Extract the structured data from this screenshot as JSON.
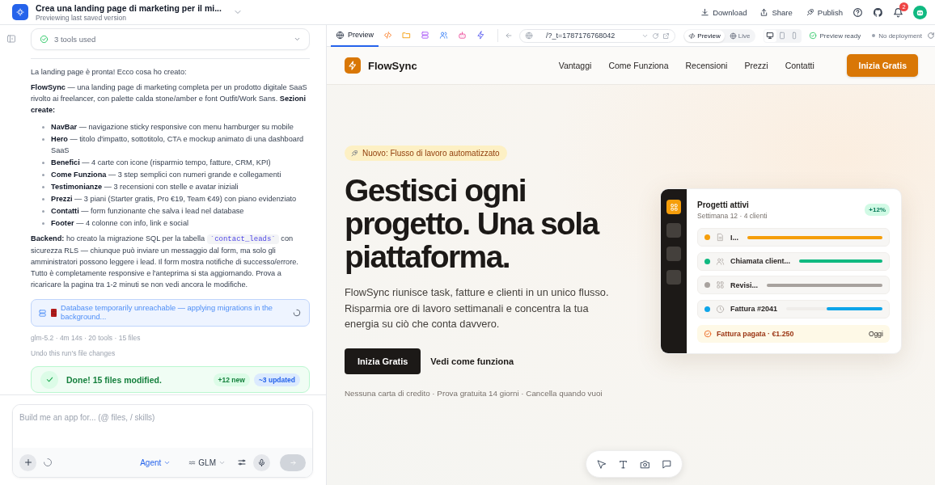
{
  "header": {
    "title": "Crea una landing page di marketing per il mi...",
    "subtitle": "Previewing last saved version",
    "actions": [
      {
        "label": "Download"
      },
      {
        "label": "Share"
      },
      {
        "label": "Publish"
      }
    ],
    "notification_count": "2"
  },
  "chat": {
    "tools_summary": "3 tools used",
    "intro": "La landing page è pronta! Ecco cosa ho creato:",
    "summary": "**FlowSync** — una landing page di marketing completa per un prodotto digitale SaaS rivolto ai freelancer, con palette calda stone/amber e font Outfit/Work Sans. **Sezioni create:**",
    "sections": [
      "**NavBar** — navigazione sticky responsive con menu hamburger su mobile",
      "**Hero** — titolo d'impatto, sottotitolo, CTA e mockup animato di una dashboard SaaS",
      "**Benefici** — 4 carte con icone (risparmio tempo, fatture, CRM, KPI)",
      "**Come Funziona** — 3 step semplici con numeri grande e collegamenti",
      "**Testimonianze** — 3 recensioni con stelle e avatar iniziali",
      "**Prezzi** — 3 piani (Starter gratis, Pro €19, Team €49) con piano evidenziato",
      "**Contatti** — form funzionante che salva i lead nel database",
      "**Footer** — 4 colonne con info, link e social"
    ],
    "backend": {
      "before": "**Backend:** ho creato la migrazione SQL per la tabella",
      "code": "`contact_leads`",
      "after": "con sicurezza RLS — chiunque può inviare un messaggio dal form, ma solo gli amministratori possono leggere i lead. Il form mostra notifiche di successo/errore. Tutto è completamente responsive e l'anteprima si sta aggiornando. Prova a ricaricare la pagina tra 1-2 minuti se non vedi ancora le modifiche."
    },
    "status_notice": "Database temporarily unreachable — applying migrations in the background...",
    "run_meta": "glm-5.2 · 4m 14s · 20 tools · 15 files",
    "undo_link": "Undo this run's file changes",
    "done": {
      "message": "Done! 15 files modified.",
      "new": "+12 new",
      "updated": "~3 updated"
    },
    "composer": {
      "placeholder": "Build me an app for... (@ files, / skills)",
      "mode": "Agent",
      "model": "GLM"
    }
  },
  "preview": {
    "tabs": [
      {
        "label": "Preview",
        "selected": true
      },
      {
        "selected": false
      },
      {
        "selected": false
      },
      {
        "selected": false
      },
      {
        "selected": false
      },
      {
        "selected": false
      },
      {
        "selected": false
      }
    ],
    "url": "/?_t=1787176768042",
    "view_modes": [
      {
        "label": "Preview",
        "selected": true
      },
      {
        "label": "Live",
        "selected": false
      }
    ],
    "devices": [
      {
        "selected": true
      },
      {
        "selected": false
      },
      {
        "selected": false
      }
    ],
    "status": "Preview ready",
    "deployment": "No deployment"
  },
  "site": {
    "nav": {
      "brand": "FlowSync",
      "links": [
        "Vantaggi",
        "Come Funziona",
        "Recensioni",
        "Prezzi",
        "Contatti"
      ],
      "cta": "Inizia Gratis"
    },
    "hero": {
      "badge": "Nuovo: Flusso di lavoro automatizzato",
      "headline": "Gestisci ogni progetto. Una sola piattaforma.",
      "body": "FlowSync riunisce task, fatture e clienti in un unico flusso. Risparmia ore di lavoro settimanali e concentra la tua energia su ciò che conta davvero.",
      "primary_cta": "Inizia Gratis",
      "secondary_cta": "Vedi come funziona",
      "footnote": "Nessuna carta di credito · Prova gratuita 14 giorni · Cancella quando vuoi"
    },
    "dashboard": {
      "rail": [
        {
          "selected": true
        },
        {
          "selected": false
        },
        {
          "selected": false
        },
        {
          "selected": false
        }
      ],
      "title": "Progetti attivi",
      "subtitle": "Settimana 12 · 4 clienti",
      "badge": "+12%",
      "tasks": [
        {
          "label": "I...",
          "color": "#f59e0b",
          "level": 1
        },
        {
          "label": "Chiamata client...",
          "color": "#10b981",
          "level": 1
        },
        {
          "label": "Revisi...",
          "color": "#a8a29e",
          "level": 1
        },
        {
          "label": "Fattura #2041",
          "color": "#0ea5e9",
          "level": 0.58
        }
      ],
      "notice": {
        "text": "Fattura pagata · €1.250",
        "time": "Oggi"
      }
    }
  }
}
